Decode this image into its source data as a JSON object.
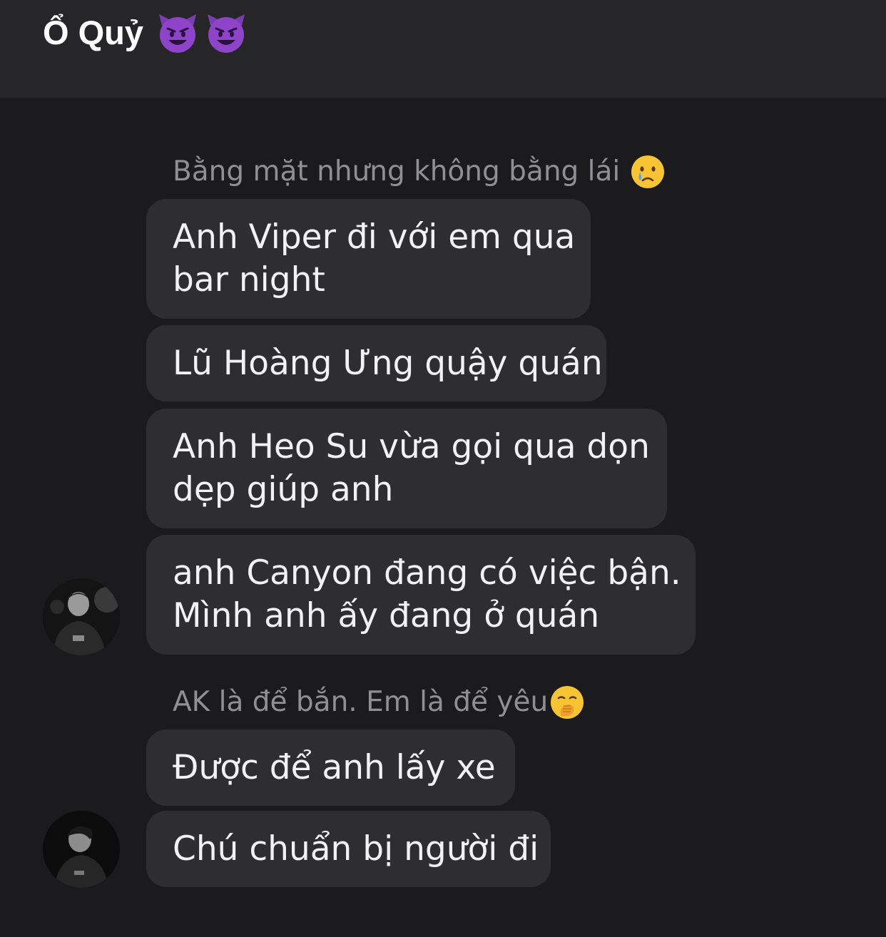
{
  "header": {
    "title": "Ổ Quỷ",
    "title_emojis": [
      "smiling-devil-emoji",
      "smiling-devil-emoji"
    ]
  },
  "groups": [
    {
      "sender": "Bằng mặt nhưng không bằng lái",
      "sender_emoji": "crying-face-emoji",
      "messages": [
        {
          "lines": [
            "Anh Viper đi với em qua",
            "bar night"
          ]
        },
        {
          "lines": [
            "Lũ Hoàng Ưng quậy quán"
          ]
        },
        {
          "lines": [
            "Anh Heo Su vừa gọi qua dọn",
            "dẹp giúp anh"
          ]
        },
        {
          "lines": [
            "anh Canyon đang có việc bận.",
            "Mình anh ấy đang ở quán"
          ]
        }
      ]
    },
    {
      "sender": "AK là để bắn. Em là để yêu",
      "sender_emoji": "face-with-hand-over-mouth-emoji",
      "messages": [
        {
          "lines": [
            "Được để anh lấy xe"
          ]
        },
        {
          "lines": [
            "Chú chuẩn bị người đi"
          ]
        }
      ]
    }
  ],
  "colors": {
    "background": "#1b1b1d",
    "header": "#262628",
    "bubble": "#2e2e30",
    "text": "#f2f2f4",
    "sender_name": "#8f8f94",
    "devil_purple": "#8e44c9"
  }
}
